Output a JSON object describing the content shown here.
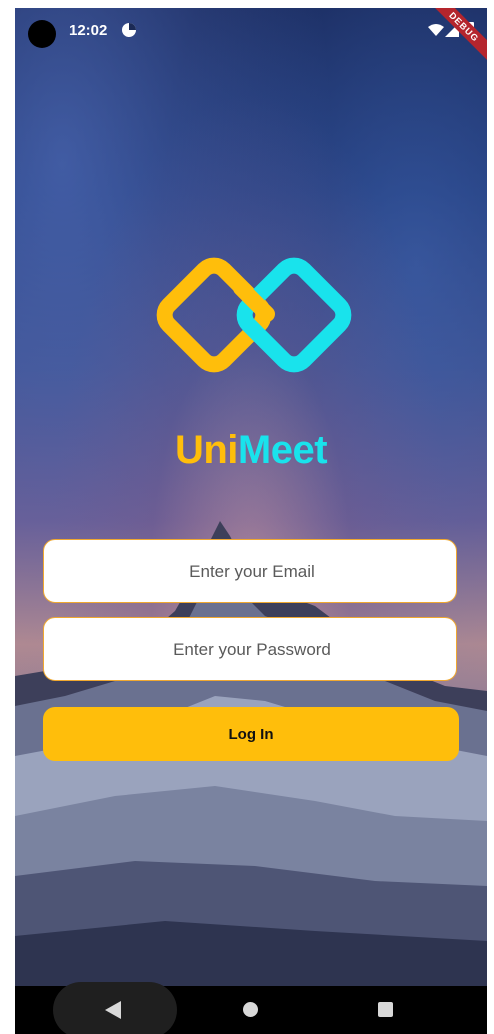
{
  "status_bar": {
    "time": "12:02",
    "icons": [
      "app-notification-icon",
      "wifi-icon",
      "signal-icon",
      "battery-icon"
    ],
    "debug_banner": "DEBUG"
  },
  "brand": {
    "name_part1": "Uni",
    "name_part2": "Meet",
    "color_part1": "#ffbe0b",
    "color_part2": "#19e3ec"
  },
  "form": {
    "email_placeholder": "Enter your Email",
    "email_value": "",
    "password_placeholder": "Enter your Password",
    "password_value": "",
    "login_label": "Log In"
  },
  "nav_bar": {
    "icons": [
      "back-icon",
      "home-icon",
      "recents-icon"
    ]
  },
  "colors": {
    "accent_yellow": "#ffbe0b",
    "accent_cyan": "#19e3ec",
    "field_border": "#f0a830"
  }
}
